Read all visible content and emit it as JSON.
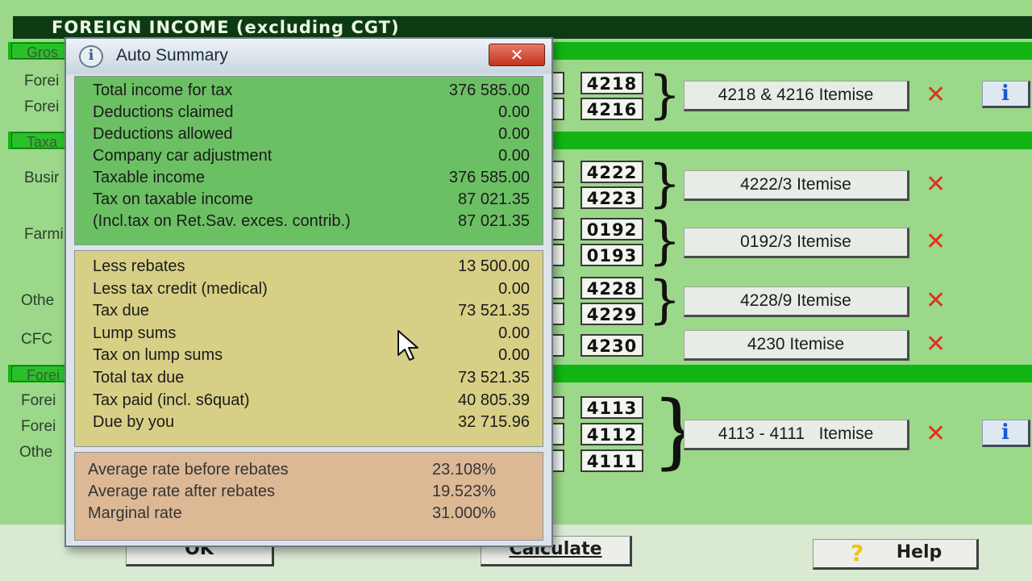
{
  "form": {
    "title": "FOREIGN INCOME (excluding CGT)",
    "sections": [
      "Gros",
      "Taxa",
      "Forei"
    ],
    "row_labels": [
      "Forei",
      "Forei",
      "Busir",
      "Farmi",
      "Othe",
      "CFC",
      "Forei",
      "Forei",
      "Othe"
    ],
    "codes": [
      "4218",
      "4216",
      "4222",
      "4223",
      "0192",
      "0193",
      "4228",
      "4229",
      "4230",
      "4113",
      "4112",
      "4111"
    ],
    "itemise_buttons": [
      "4218 & 4216 Itemise",
      "4222/3 Itemise",
      "0192/3 Itemise",
      "4228/9 Itemise",
      "4230 Itemise",
      "4113 - 4111   Itemise"
    ],
    "bottom_buttons": {
      "ok": "OK",
      "calculate": "Calculate",
      "help": "Help"
    }
  },
  "dialog": {
    "title": "Auto Summary",
    "close_label": "✕",
    "income_rows": [
      {
        "label": "Total income for tax",
        "value": "376 585.00"
      },
      {
        "label": "Deductions claimed",
        "value": "0.00"
      },
      {
        "label": "Deductions allowed",
        "value": "0.00"
      },
      {
        "label": "Company car adjustment",
        "value": "0.00"
      },
      {
        "label": "Taxable income",
        "value": "376 585.00"
      },
      {
        "label": "Tax on taxable income",
        "value": "87 021.35"
      },
      {
        "label": "(Incl.tax on Ret.Sav. exces. contrib.)",
        "value": "87 021.35"
      }
    ],
    "tax_rows": [
      {
        "label": "Less rebates",
        "value": "13 500.00"
      },
      {
        "label": "Less tax credit (medical)",
        "value": "0.00"
      },
      {
        "label": "Tax due",
        "value": "73 521.35"
      },
      {
        "label": "Lump sums",
        "value": "0.00"
      },
      {
        "label": "Tax on lump sums",
        "value": "0.00"
      },
      {
        "label": "Total tax due",
        "value": "73 521.35"
      },
      {
        "label": "Tax paid (incl. s6quat)",
        "value": "40 805.39"
      },
      {
        "label": "Due by you",
        "value": "32 715.96"
      }
    ],
    "rate_rows": [
      {
        "label": "Average rate before rebates",
        "value": "23.108%"
      },
      {
        "label": "Average rate after rebates",
        "value": "19.523%"
      },
      {
        "label": "Marginal rate",
        "value": "31.000%"
      }
    ]
  },
  "colors": {
    "form_background": "#9bd88a",
    "title_bar": "#0d3a12",
    "section_bar": "#13b515",
    "panel_income": "#6cc064",
    "panel_tax": "#d7cf85",
    "panel_rates": "#dcb895",
    "delete_icon": "#e0311f",
    "info_icon": "#1b58d4"
  },
  "icons": {
    "dialog_icon": "info-icon",
    "delete": "x-icon",
    "info": "info-icon",
    "help": "question-icon",
    "cursor": "mouse-pointer"
  }
}
